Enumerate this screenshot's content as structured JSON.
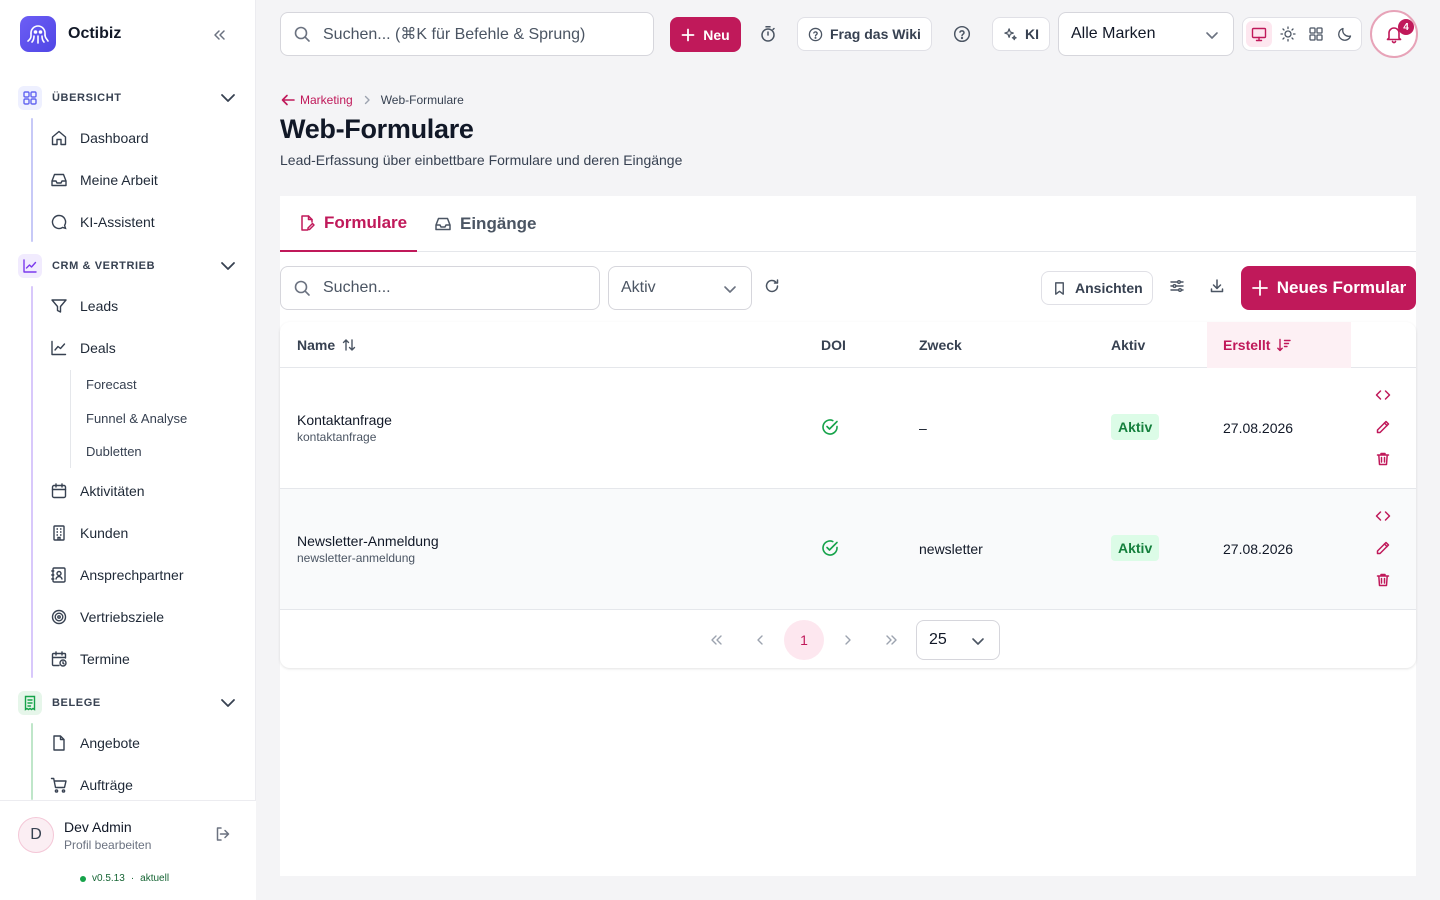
{
  "app": {
    "name": "Octibiz",
    "brand_color": "#c0195a"
  },
  "sidebar": {
    "sections": [
      {
        "label": "ÜBERSICHT",
        "icon": "grid-icon",
        "color": "#6366f1",
        "items": [
          {
            "label": "Dashboard",
            "icon": "home-icon"
          },
          {
            "label": "Meine Arbeit",
            "icon": "inbox-icon"
          },
          {
            "label": "KI-Assistent",
            "icon": "chat-search-icon"
          }
        ]
      },
      {
        "label": "CRM & VERTRIEB",
        "icon": "trending-chart-icon",
        "color": "#7c3aed",
        "items": [
          {
            "label": "Leads",
            "icon": "funnel-icon"
          },
          {
            "label": "Deals",
            "icon": "line-chart-icon"
          },
          {
            "label": "Aktivitäten",
            "icon": "calendar-icon"
          },
          {
            "label": "Kunden",
            "icon": "building-icon"
          },
          {
            "label": "Ansprechpartner",
            "icon": "contact-card-icon"
          },
          {
            "label": "Vertriebsziele",
            "icon": "target-icon"
          },
          {
            "label": "Termine",
            "icon": "calendar-clock-icon"
          }
        ],
        "sub_items": [
          "Forecast",
          "Funnel & Analyse",
          "Dubletten"
        ]
      },
      {
        "label": "BELEGE",
        "icon": "receipt-icon",
        "color": "#16a34a",
        "items": [
          {
            "label": "Angebote",
            "icon": "file-icon"
          },
          {
            "label": "Aufträge",
            "icon": "cart-icon"
          }
        ]
      }
    ],
    "user": {
      "initial": "D",
      "name": "Dev Admin",
      "subtitle": "Profil bearbeiten"
    },
    "version": "v0.5.13",
    "version_status": "aktuell"
  },
  "topbar": {
    "search_placeholder": "Suchen... (⌘K für Befehle & Sprung)",
    "new_label": "Neu",
    "wiki_label": "Frag das Wiki",
    "ai_label": "KI",
    "brand_filter": "Alle Marken",
    "notification_count": "4"
  },
  "page": {
    "breadcrumb": {
      "parent": "Marketing",
      "current": "Web-Formulare"
    },
    "title": "Web-Formulare",
    "subtitle": "Lead-Erfassung über einbettbare Formulare und deren Eingänge",
    "tabs": [
      {
        "label": "Formulare",
        "active": true
      },
      {
        "label": "Eingänge",
        "active": false
      }
    ],
    "filters": {
      "search_placeholder": "Suchen...",
      "status_value": "Aktiv",
      "views_label": "Ansichten",
      "new_form_label": "Neues Formular"
    },
    "table": {
      "columns": [
        "Name",
        "DOI",
        "Zweck",
        "Aktiv",
        "Erstellt"
      ],
      "rows": [
        {
          "name": "Kontaktanfrage",
          "slug": "kontaktanfrage",
          "doi": true,
          "purpose": "–",
          "active": "Aktiv",
          "created": "27.08.2026"
        },
        {
          "name": "Newsletter-Anmeldung",
          "slug": "newsletter-anmeldung",
          "doi": true,
          "purpose": "newsletter",
          "active": "Aktiv",
          "created": "27.08.2026"
        }
      ]
    },
    "pagination": {
      "current_page": "1",
      "page_size": "25"
    }
  }
}
